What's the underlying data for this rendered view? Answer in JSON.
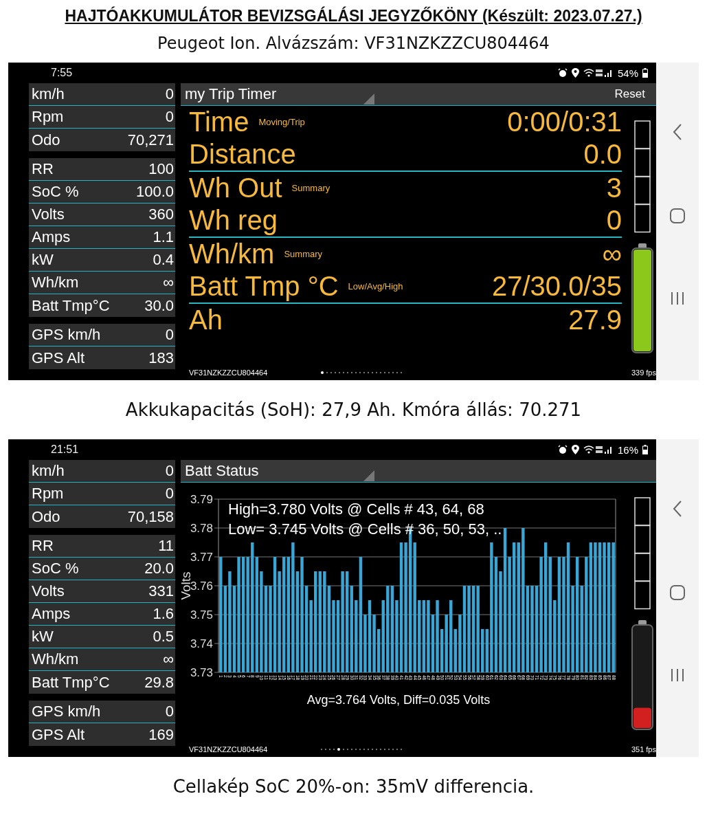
{
  "title": "HAJTÓAKKUMULÁTOR BEVIZSGÁLÁSI JEGYZŐKÖNY (Készült: 2023.07.27.)",
  "subtitle": "Peugeot Ion. Alvázszám: VF31NZKZZCU804464",
  "screens": [
    {
      "kind": "trip",
      "status_bar": {
        "time": "7:55",
        "battery": "54%"
      },
      "side_groups": [
        [
          {
            "label": "km/h",
            "value": "0"
          },
          {
            "label": "Rpm",
            "value": "0"
          },
          {
            "label": "Odo",
            "value": "70,271"
          }
        ],
        [
          {
            "label": "RR",
            "value": "100"
          },
          {
            "label": "SoC %",
            "value": "100.0"
          },
          {
            "label": "Volts",
            "value": "360"
          },
          {
            "label": "Amps",
            "value": "1.1"
          },
          {
            "label": "kW",
            "value": "0.4"
          },
          {
            "label": "Wh/km",
            "value": "∞"
          },
          {
            "label": "Batt Tmp°C",
            "value": "30.0"
          }
        ],
        [
          {
            "label": "GPS km/h",
            "value": "0"
          },
          {
            "label": "GPS Alt",
            "value": "183"
          }
        ]
      ],
      "panel": {
        "title": "my Trip Timer",
        "action": "Reset",
        "row_groups": [
          [
            {
              "label": "Time",
              "note": "Moving/Trip",
              "value": "0:00/0:31"
            },
            {
              "label": "Distance",
              "value": "0.0"
            }
          ],
          [
            {
              "label": "Wh Out",
              "note": "Summary",
              "value": "3"
            },
            {
              "label": "Wh reg",
              "value": "0"
            }
          ],
          [
            {
              "label": "Wh/km",
              "note": "Summary",
              "value": "∞"
            },
            {
              "label": "Batt Tmp °C",
              "note": "Low/Avg/High",
              "value": "27/30.0/35"
            }
          ],
          [
            {
              "label": "Ah",
              "value": "27.9"
            }
          ]
        ]
      },
      "battery": {
        "level": 1.0
      },
      "footer": {
        "vin": "VF31NZKZZCU804464",
        "fps": "339 fps"
      },
      "page_dots": [
        {
          "selected": true
        },
        {
          "selected": false
        },
        {
          "selected": false
        },
        {
          "selected": false
        },
        {
          "selected": false
        },
        {
          "selected": false
        },
        {
          "selected": false
        },
        {
          "selected": false
        },
        {
          "selected": false
        },
        {
          "selected": false
        },
        {
          "selected": false
        },
        {
          "selected": false
        },
        {
          "selected": false
        },
        {
          "selected": false
        },
        {
          "selected": false
        },
        {
          "selected": false
        },
        {
          "selected": false
        },
        {
          "selected": false
        },
        {
          "selected": false
        },
        {
          "selected": false
        }
      ],
      "caption": "Akkukapacitás (SoH): 27,9 Ah. Kmóra állás: 70.271"
    },
    {
      "kind": "batt",
      "status_bar": {
        "time": "21:51",
        "battery": "16%"
      },
      "side_groups": [
        [
          {
            "label": "km/h",
            "value": "0"
          },
          {
            "label": "Rpm",
            "value": "0"
          },
          {
            "label": "Odo",
            "value": "70,158"
          }
        ],
        [
          {
            "label": "RR",
            "value": "11"
          },
          {
            "label": "SoC %",
            "value": "20.0"
          },
          {
            "label": "Volts",
            "value": "331"
          },
          {
            "label": "Amps",
            "value": "1.6"
          },
          {
            "label": "kW",
            "value": "0.5"
          },
          {
            "label": "Wh/km",
            "value": "∞"
          },
          {
            "label": "Batt Tmp°C",
            "value": "29.8"
          }
        ],
        [
          {
            "label": "GPS km/h",
            "value": "0"
          },
          {
            "label": "GPS Alt",
            "value": "169"
          }
        ]
      ],
      "panel": {
        "title": "Batt Status",
        "chart_data": {
          "type": "bar",
          "grid": true,
          "ylabel": "Volts",
          "ylim": [
            3.73,
            3.79
          ],
          "yticks": [
            3.73,
            3.74,
            3.75,
            3.76,
            3.77,
            3.78,
            3.79
          ],
          "categories": [
            "1",
            "2",
            "3",
            "4",
            "5",
            "6",
            "7",
            "8",
            "9",
            "10",
            "11",
            "12",
            "13",
            "14",
            "15",
            "16",
            "17",
            "18",
            "19",
            "20",
            "21",
            "22",
            "23",
            "24",
            "25",
            "26",
            "27",
            "28",
            "29",
            "30",
            "31",
            "32",
            "33",
            "34",
            "35",
            "36",
            "37",
            "38",
            "39",
            "40",
            "41",
            "42",
            "43",
            "44",
            "45",
            "46",
            "47",
            "48",
            "49",
            "50",
            "51",
            "52",
            "53",
            "54",
            "55",
            "56",
            "57",
            "58",
            "59",
            "60",
            "61",
            "62",
            "63",
            "64",
            "65",
            "66",
            "67",
            "68",
            "69",
            "70",
            "71",
            "72",
            "73",
            "74",
            "75",
            "76",
            "77",
            "78",
            "79",
            "80",
            "81",
            "82",
            "83",
            "84",
            "85",
            "86",
            "87",
            "88"
          ],
          "series": [
            {
              "color": "#3aa6d6",
              "values": [
                3.77,
                3.76,
                3.765,
                3.76,
                3.77,
                3.77,
                3.77,
                3.775,
                3.77,
                3.765,
                3.76,
                3.76,
                3.77,
                3.765,
                3.77,
                3.77,
                3.775,
                3.765,
                3.77,
                3.76,
                3.755,
                3.765,
                3.765,
                3.765,
                3.76,
                3.755,
                3.755,
                3.765,
                3.765,
                3.76,
                3.755,
                3.77,
                3.75,
                3.755,
                3.75,
                3.745,
                3.755,
                3.76,
                3.76,
                3.755,
                3.775,
                3.775,
                3.78,
                3.775,
                3.755,
                3.755,
                3.755,
                3.75,
                3.755,
                3.745,
                3.75,
                3.755,
                3.745,
                3.75,
                3.76,
                3.76,
                3.76,
                3.76,
                3.745,
                3.745,
                3.775,
                3.77,
                3.765,
                3.78,
                3.77,
                3.775,
                3.775,
                3.78,
                3.76,
                3.76,
                3.76,
                3.77,
                3.775,
                3.77,
                3.755,
                3.77,
                3.77,
                3.775,
                3.76,
                3.77,
                3.76,
                3.77,
                3.775,
                3.775,
                3.775,
                3.775,
                3.775,
                3.775
              ]
            }
          ],
          "annotations": [
            "High=3.780 Volts @ Cells # 43, 64, 68",
            "Low= 3.745 Volts @ Cells # 36, 50, 53, .."
          ]
        },
        "summary": "Avg=3.764 Volts, Diff=0.035 Volts"
      },
      "battery": {
        "level": 0.2
      },
      "footer": {
        "vin": "VF31NZKZZCU804464",
        "fps": "351 fps"
      },
      "page_dots": [
        {
          "selected": false
        },
        {
          "selected": false
        },
        {
          "selected": false
        },
        {
          "selected": false
        },
        {
          "selected": true
        },
        {
          "selected": false
        },
        {
          "selected": false
        },
        {
          "selected": false
        },
        {
          "selected": false
        },
        {
          "selected": false
        },
        {
          "selected": false
        },
        {
          "selected": false
        },
        {
          "selected": false
        },
        {
          "selected": false
        },
        {
          "selected": false
        },
        {
          "selected": false
        },
        {
          "selected": false
        },
        {
          "selected": false
        },
        {
          "selected": false
        },
        {
          "selected": false
        }
      ],
      "caption": "Cellakép SoC 20%-on: 35mV differencia."
    }
  ]
}
